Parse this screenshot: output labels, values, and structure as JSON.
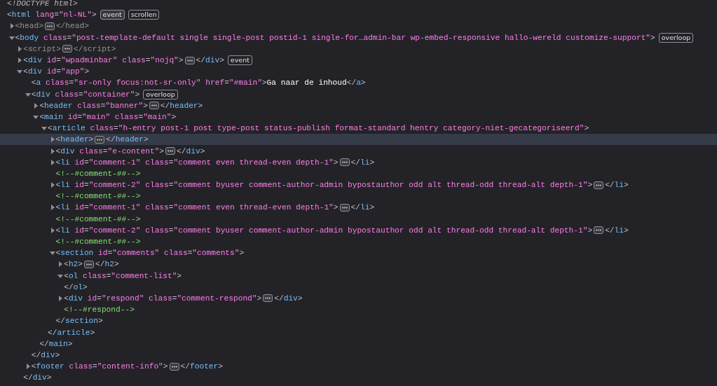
{
  "nodes": [
    {
      "kind": "doctype",
      "text": "<!DOCTYPE html>",
      "selected": false
    },
    {
      "kind": "element",
      "open": "<html lang=\"nl-NL\">",
      "dimmed": false,
      "badges": [
        "event",
        "scrollen"
      ],
      "selected": false,
      "children": [
        {
          "kind": "element",
          "expanded": false,
          "open": "<head>",
          "close": "</head>",
          "dimmed": true,
          "selected": false
        },
        {
          "kind": "element",
          "expanded": true,
          "open": "<body class=\"post-template-default single single-post postid-1 single-for…admin-bar wp-embed-responsive hallo-wereld customize-support\">",
          "dimmed": false,
          "badges": [
            "overloop"
          ],
          "selected": false,
          "children": [
            {
              "kind": "element",
              "expanded": false,
              "open": "<script>",
              "close": "</script>",
              "dimmed": true,
              "selected": false
            },
            {
              "kind": "element",
              "expanded": false,
              "open": "<div id=\"wpadminbar\" class=\"nojq\">",
              "close": "</div>",
              "dimmed": false,
              "badges": [
                "event"
              ],
              "selected": false
            },
            {
              "kind": "element",
              "expanded": true,
              "open": "<div id=\"app\">",
              "close": "</div>",
              "dimmed": false,
              "selected": false,
              "children": [
                {
                  "kind": "element",
                  "open": "<a class=\"sr-only focus:not-sr-only\" href=\"#main\">",
                  "text": "Ga naar de inhoud",
                  "close": "</a>",
                  "dimmed": false,
                  "link_value": true,
                  "selected": false
                },
                {
                  "kind": "element",
                  "expanded": true,
                  "open": "<div class=\"container\">",
                  "close": "</div>",
                  "dimmed": false,
                  "badges": [
                    "overloop"
                  ],
                  "selected": false,
                  "children": [
                    {
                      "kind": "element",
                      "expanded": false,
                      "open": "<header class=\"banner\">",
                      "close": "</header>",
                      "dimmed": false,
                      "selected": false
                    },
                    {
                      "kind": "element",
                      "expanded": true,
                      "open": "<main id=\"main\" class=\"main\">",
                      "close": "</main>",
                      "dimmed": false,
                      "selected": false,
                      "children": [
                        {
                          "kind": "element",
                          "expanded": true,
                          "open": "<article class=\"h-entry post-1 post type-post status-publish format-standard hentry category-niet-gecategoriseerd\">",
                          "close": "</article>",
                          "dimmed": false,
                          "selected": false,
                          "children": [
                            {
                              "kind": "element",
                              "expanded": false,
                              "open": "<header>",
                              "close": "</header>",
                              "dimmed": false,
                              "selected": true
                            },
                            {
                              "kind": "element",
                              "expanded": false,
                              "open": "<div class=\"e-content\">",
                              "close": "</div>",
                              "dimmed": false,
                              "selected": false
                            },
                            {
                              "kind": "element",
                              "expanded": false,
                              "open": "<li id=\"comment-1\" class=\"comment even thread-even depth-1\">",
                              "close": "</li>",
                              "dimmed": false,
                              "selected": false
                            },
                            {
                              "kind": "comment",
                              "text": "<!--#comment-##-->",
                              "selected": false
                            },
                            {
                              "kind": "element",
                              "expanded": false,
                              "open": "<li id=\"comment-2\" class=\"comment byuser comment-author-admin bypostauthor odd alt thread-odd thread-alt depth-1\">",
                              "close": "</li>",
                              "dimmed": false,
                              "selected": false
                            },
                            {
                              "kind": "comment",
                              "text": "<!--#comment-##-->",
                              "selected": false
                            },
                            {
                              "kind": "element",
                              "expanded": false,
                              "open": "<li id=\"comment-1\" class=\"comment even thread-even depth-1\">",
                              "close": "</li>",
                              "dimmed": false,
                              "selected": false
                            },
                            {
                              "kind": "comment",
                              "text": "<!--#comment-##-->",
                              "selected": false
                            },
                            {
                              "kind": "element",
                              "expanded": false,
                              "open": "<li id=\"comment-2\" class=\"comment byuser comment-author-admin bypostauthor odd alt thread-odd thread-alt depth-1\">",
                              "close": "</li>",
                              "dimmed": false,
                              "selected": false
                            },
                            {
                              "kind": "comment",
                              "text": "<!--#comment-##-->",
                              "selected": false
                            },
                            {
                              "kind": "element",
                              "expanded": true,
                              "open": "<section id=\"comments\" class=\"comments\">",
                              "close": "</section>",
                              "dimmed": false,
                              "selected": false,
                              "children": [
                                {
                                  "kind": "element",
                                  "expanded": false,
                                  "open": "<h2>",
                                  "close": "</h2>",
                                  "dimmed": false,
                                  "selected": false
                                },
                                {
                                  "kind": "element",
                                  "expanded": true,
                                  "open": "<ol class=\"comment-list\">",
                                  "close": "</ol>",
                                  "dimmed": false,
                                  "selected": false
                                },
                                {
                                  "kind": "element",
                                  "expanded": false,
                                  "open": "<div id=\"respond\" class=\"comment-respond\">",
                                  "close": "</div>",
                                  "dimmed": false,
                                  "selected": false
                                },
                                {
                                  "kind": "comment",
                                  "text": "<!--#respond-->",
                                  "selected": false
                                }
                              ]
                            }
                          ]
                        }
                      ]
                    }
                  ]
                },
                {
                  "kind": "element",
                  "expanded": false,
                  "open": "<footer class=\"content-info\">",
                  "close": "</footer>",
                  "dimmed": false,
                  "selected": false
                }
              ]
            }
          ]
        }
      ]
    }
  ]
}
